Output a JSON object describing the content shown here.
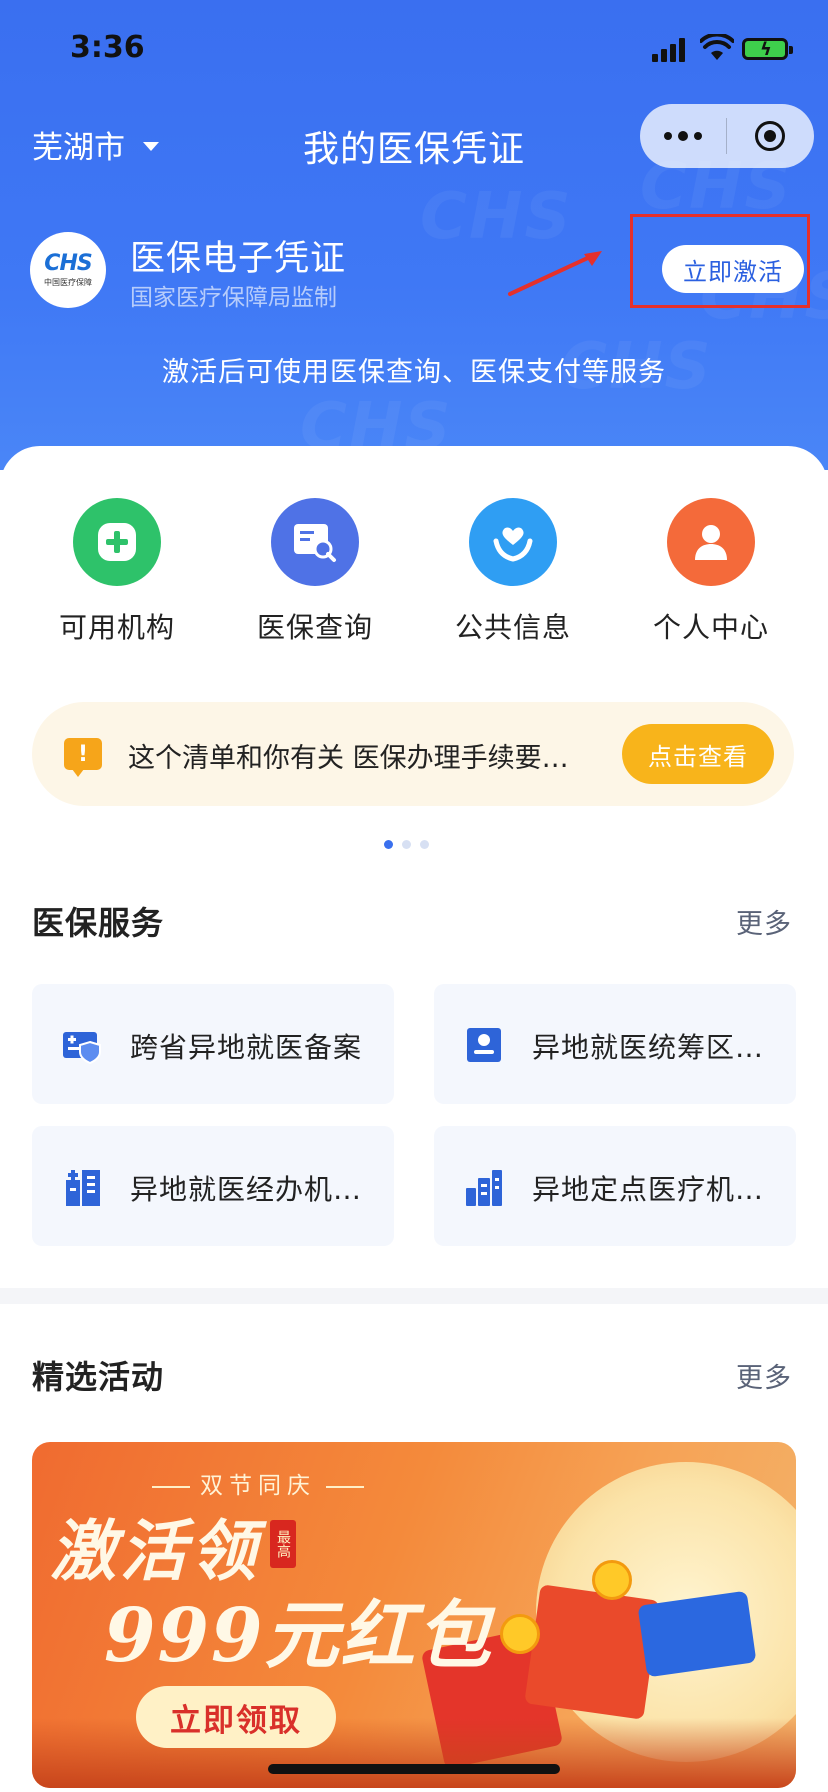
{
  "status_bar": {
    "time": "3:36"
  },
  "nav": {
    "city": "芜湖市",
    "title": "我的医保凭证"
  },
  "card": {
    "logo_mark": "CHS",
    "logo_sub": "中国医疗保障",
    "title": "医保电子凭证",
    "subtitle": "国家医疗保障局监制",
    "activate_label": "立即激活",
    "description": "激活后可使用医保查询、医保支付等服务"
  },
  "quick_actions": [
    {
      "label": "可用机构",
      "icon": "plus-icon",
      "color": "#2ec26a"
    },
    {
      "label": "医保查询",
      "icon": "search-card-icon",
      "color": "#4f72e6"
    },
    {
      "label": "公共信息",
      "icon": "heart-hands-icon",
      "color": "#2f9ef3"
    },
    {
      "label": "个人中心",
      "icon": "person-icon",
      "color": "#f46a3a"
    }
  ],
  "notice": {
    "text": "这个清单和你有关 医保办理手续要…",
    "button_label": "点击查看"
  },
  "services": {
    "title": "医保服务",
    "more_label": "更多",
    "items": [
      {
        "label": "跨省异地就医备案"
      },
      {
        "label": "异地就医统筹区…"
      },
      {
        "label": "异地就医经办机…"
      },
      {
        "label": "异地定点医疗机…"
      }
    ]
  },
  "activities": {
    "title": "精选活动",
    "more_label": "更多",
    "banner": {
      "top_line": "双节同庆",
      "headline": "激活领",
      "tag": "最高",
      "amount_line": "999元红包",
      "button_label": "立即领取"
    }
  },
  "colors": {
    "brand_blue": "#3a6ff0",
    "accent_orange": "#f8b41b",
    "highlight_red": "#e5302b"
  }
}
